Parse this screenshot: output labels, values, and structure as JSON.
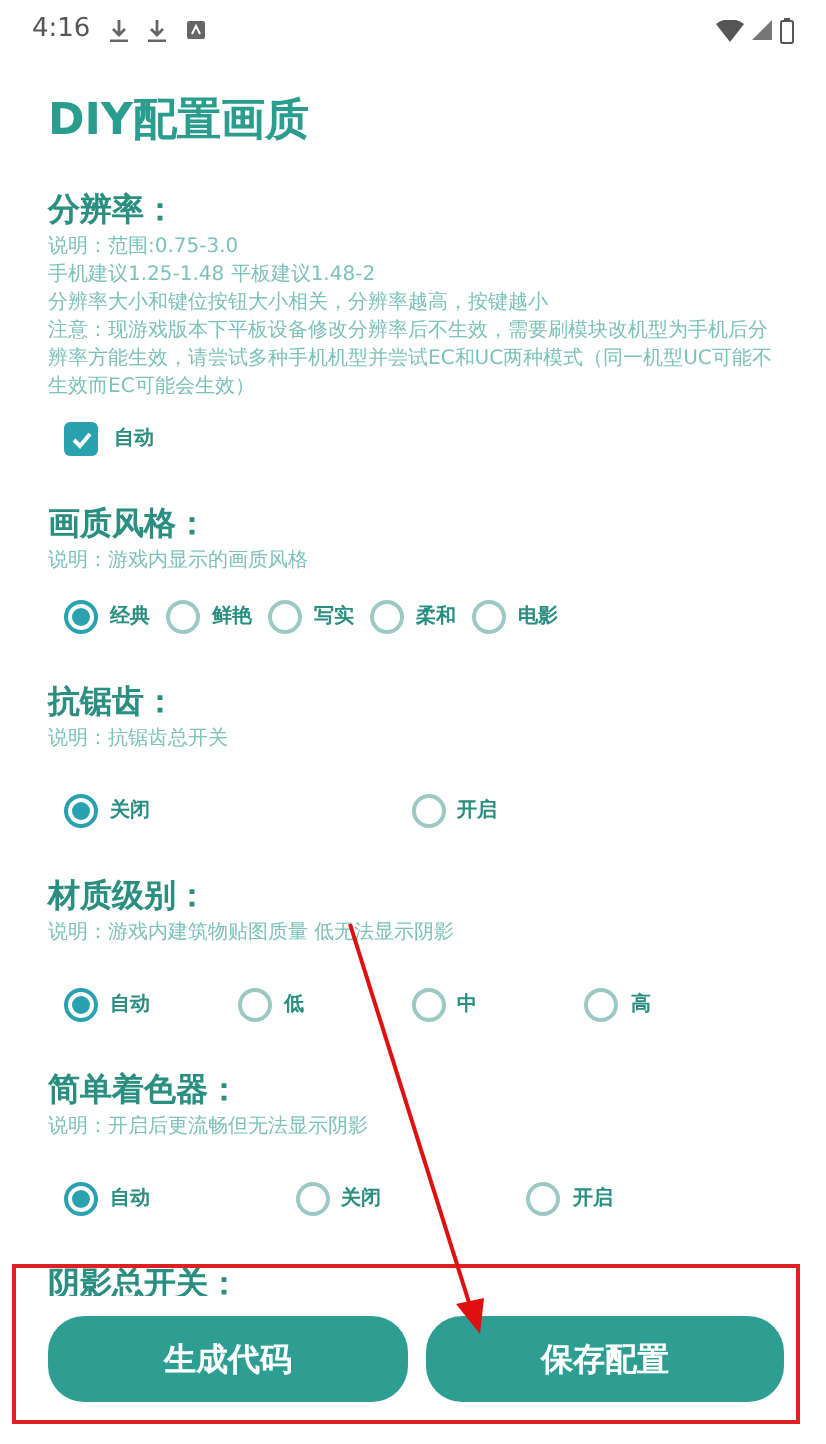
{
  "status_bar": {
    "time": "4:16"
  },
  "title": "DIY配置画质",
  "sections": [
    {
      "title": "分辨率：",
      "description": [
        "说明：范围:0.75-3.0",
        "手机建议1.25-1.48  平板建议1.48-2",
        "分辨率大小和键位按钮大小相关，分辨率越高，按键越小",
        "注意：现游戏版本下平板设备修改分辨率后不生效，需要刷模块改机型为手机后分辨率方能生效，请尝试多种手机机型并尝试EC和UC两种模式（同一机型UC可能不生效而EC可能会生效）"
      ],
      "kind": "checkbox",
      "options": [
        {
          "label": "自动",
          "checked": true
        }
      ]
    },
    {
      "title": "画质风格：",
      "description": [
        "说明：游戏内显示的画质风格"
      ],
      "kind": "inline",
      "options": [
        {
          "label": "经典",
          "selected": true
        },
        {
          "label": "鲜艳",
          "selected": false
        },
        {
          "label": "写实",
          "selected": false
        },
        {
          "label": "柔和",
          "selected": false
        },
        {
          "label": "电影",
          "selected": false
        }
      ]
    },
    {
      "title": "抗锯齿：",
      "description": [
        "说明：抗锯齿总开关"
      ],
      "kind": "spread",
      "options": [
        {
          "label": "关闭",
          "selected": true
        },
        {
          "label": "开启",
          "selected": false
        }
      ]
    },
    {
      "title": "材质级别：",
      "description": [
        "说明：游戏内建筑物贴图质量 低无法显示阴影"
      ],
      "kind": "spread",
      "options": [
        {
          "label": "自动",
          "selected": true
        },
        {
          "label": "低",
          "selected": false
        },
        {
          "label": "中",
          "selected": false
        },
        {
          "label": "高",
          "selected": false
        }
      ]
    },
    {
      "title": "简单着色器：",
      "description": [
        "说明：开启后更流畅但无法显示阴影"
      ],
      "kind": "spread",
      "options": [
        {
          "label": "自动",
          "selected": true
        },
        {
          "label": "关闭",
          "selected": false
        },
        {
          "label": "开启",
          "selected": false
        }
      ]
    },
    {
      "title": "阴影总开关：",
      "kind": "none"
    }
  ],
  "buttons": [
    "生成代码",
    "保存配置"
  ]
}
